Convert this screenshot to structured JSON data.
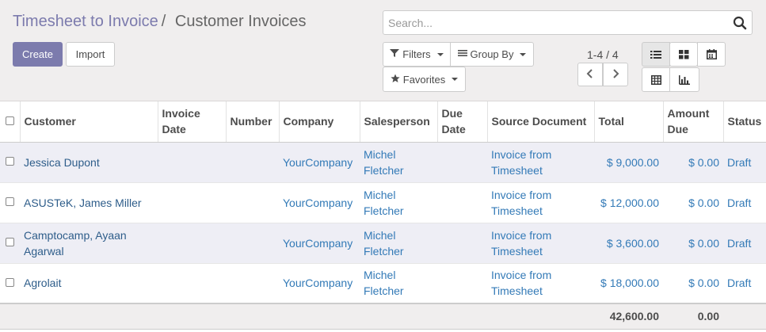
{
  "breadcrumb": {
    "parent": "Timesheet to Invoice",
    "separator": "/",
    "current": "Customer Invoices"
  },
  "buttons": {
    "create": "Create",
    "import": "Import"
  },
  "search": {
    "placeholder": "Search...",
    "icon": "search-icon"
  },
  "filters": {
    "filters_label": "Filters",
    "group_by_label": "Group By",
    "favorites_label": "Favorites"
  },
  "pager": {
    "value": "1-4 / 4"
  },
  "views": [
    "list-icon",
    "kanban-icon",
    "calendar-icon",
    "pivot-icon",
    "graph-icon"
  ],
  "table": {
    "columns": [
      "Customer",
      "Invoice Date",
      "Number",
      "Company",
      "Salesperson",
      "Due Date",
      "Source Document",
      "Total",
      "Amount Due",
      "Status"
    ],
    "rows": [
      {
        "customer": "Jessica Dupont",
        "invoice_date": "",
        "number": "",
        "company": "YourCompany",
        "salesperson": "Michel Fletcher",
        "due_date": "",
        "source": "Invoice from Timesheet",
        "total": "$ 9,000.00",
        "amount_due": "$ 0.00",
        "status": "Draft"
      },
      {
        "customer": "ASUSTeK, James Miller",
        "invoice_date": "",
        "number": "",
        "company": "YourCompany",
        "salesperson": "Michel Fletcher",
        "due_date": "",
        "source": "Invoice from Timesheet",
        "total": "$ 12,000.00",
        "amount_due": "$ 0.00",
        "status": "Draft"
      },
      {
        "customer": "Camptocamp, Ayaan Agarwal",
        "invoice_date": "",
        "number": "",
        "company": "YourCompany",
        "salesperson": "Michel Fletcher",
        "due_date": "",
        "source": "Invoice from Timesheet",
        "total": "$ 3,600.00",
        "amount_due": "$ 0.00",
        "status": "Draft"
      },
      {
        "customer": "Agrolait",
        "invoice_date": "",
        "number": "",
        "company": "YourCompany",
        "salesperson": "Michel Fletcher",
        "due_date": "",
        "source": "Invoice from Timesheet",
        "total": "$ 18,000.00",
        "amount_due": "$ 0.00",
        "status": "Draft"
      }
    ],
    "totals": {
      "total": "42,600.00",
      "amount_due": "0.00"
    }
  },
  "colors": {
    "primary": "#7c7bad",
    "link": "#337ab7",
    "odd_row": "#eeeef5"
  }
}
